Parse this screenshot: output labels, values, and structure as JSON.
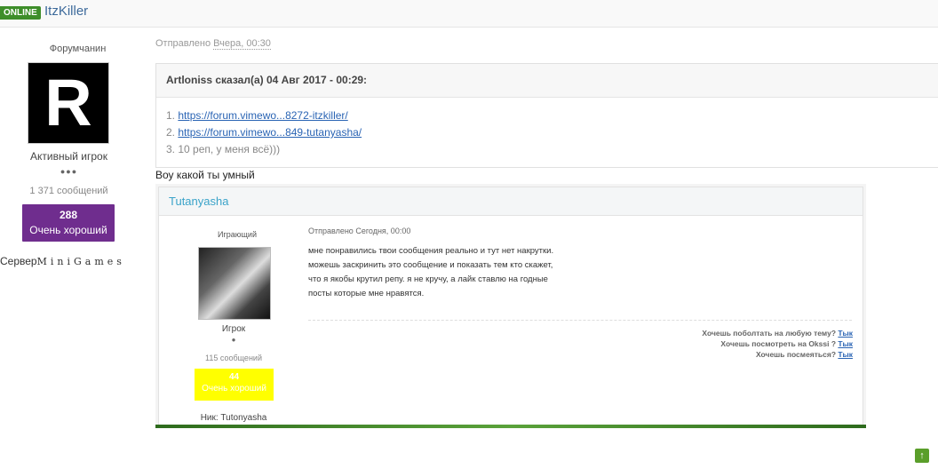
{
  "header": {
    "online_badge": "ONLINE",
    "username": "ItzKiller"
  },
  "profile": {
    "rank_title": "Форумчанин",
    "avatar_letter": "R",
    "group": "Активный игрок",
    "pips": "●●●",
    "post_count": "1 371 сообщений",
    "reputation_value": "288",
    "reputation_label": "Очень хороший",
    "server_label": "Сервер",
    "server_name": "MiniGames"
  },
  "post": {
    "sent_prefix": "Отправлено",
    "sent_time": "Вчера, 00:30",
    "quote_header": "Artloniss сказал(а) 04 Авг 2017 - 00:29:",
    "quote_line1_prefix": "1.",
    "quote_line1_link": "https://forum.vimewo...8272-itzkiller/",
    "quote_line2_prefix": "2.",
    "quote_line2_link": "https://forum.vimewo...849-tutanyasha/",
    "quote_line3": "3. 10 реп, у меня всё)))",
    "reply_text": "Воу какой ты умный"
  },
  "screenshot": {
    "author": "Tutanyasha",
    "rank_title": "Играющий",
    "avatar_caption": "",
    "group": "Игрок",
    "pip": "●",
    "post_count": "115 сообщений",
    "reputation_value": "44",
    "reputation_label": "Очень хороший",
    "nick": "Ник: Tutonyasha",
    "sent": "Отправлено Сегодня, 00:00",
    "text_line1": "мне понравились твои сообщения реально и тут нет накрутки.",
    "text_line2": "можешь заскринить это сообщение и показать тем кто скажет,",
    "text_line3": "что я якобы крутил репу. я не кручу, а лайк ставлю на годные",
    "text_line4": "посты которые мне нравятся.",
    "sig_line1": "Хочешь поболтать на любую тему?",
    "sig_line2": "Хочешь посмотреть на Okssi ?",
    "sig_line3": "Хочешь посмеяться?",
    "sig_link": "Тык"
  },
  "colors": {
    "online_badge": "#3e8e2a",
    "reputation_bg": "#6f2d8e",
    "link": "#2a64b4",
    "screenshot_rep_bg": "#ffff00"
  },
  "icons": {
    "scroll_top": "arrow-up-icon"
  }
}
